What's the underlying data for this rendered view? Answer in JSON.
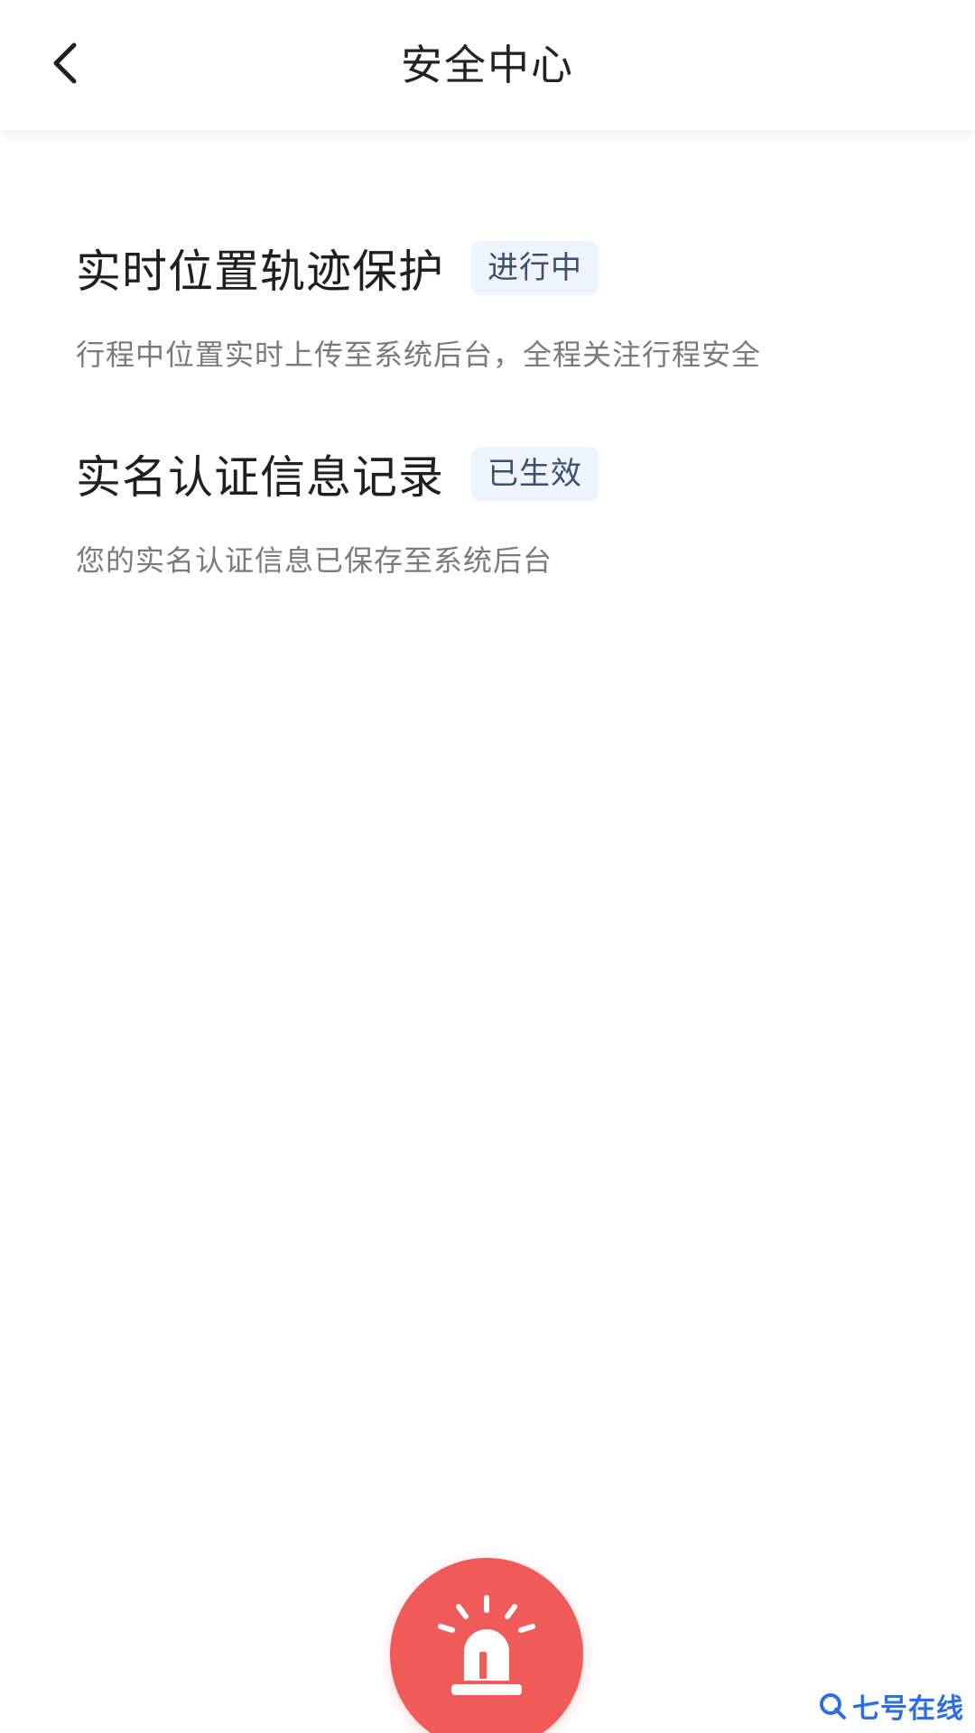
{
  "header": {
    "title": "安全中心"
  },
  "items": [
    {
      "title": "实时位置轨迹保护",
      "badge": "进行中",
      "description": "行程中位置实时上传至系统后台，全程关注行程安全"
    },
    {
      "title": "实名认证信息记录",
      "badge": "已生效",
      "description": "您的实名认证信息已保存至系统后台"
    }
  ],
  "watermark": {
    "text": "七号在线"
  },
  "colors": {
    "badge_bg": "#eef3fc",
    "badge_text": "#3c4f6e",
    "sos_red": "#f05a58",
    "watermark_blue": "#2d6fe0"
  },
  "icons": {
    "back": "chevron-left-icon",
    "sos": "alarm-light-icon",
    "watermark": "search-q-icon"
  }
}
